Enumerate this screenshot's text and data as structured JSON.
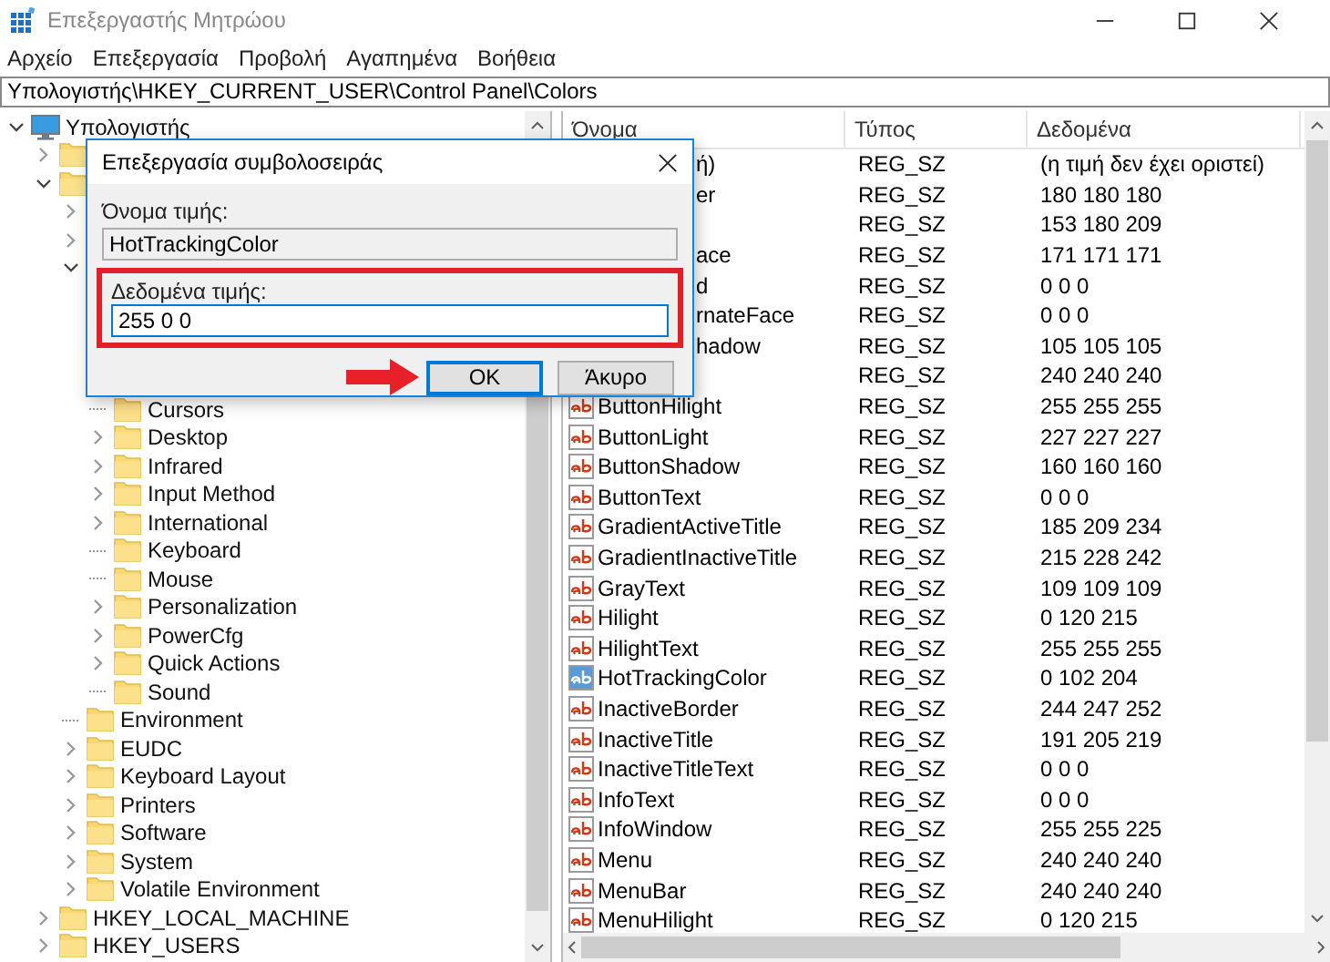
{
  "window": {
    "title": "Επεξεργαστής Μητρώου"
  },
  "menu": [
    "Αρχείο",
    "Επεξεργασία",
    "Προβολή",
    "Αγαπημένα",
    "Βοήθεια"
  ],
  "address": "Υπολογιστής\\HKEY_CURRENT_USER\\Control Panel\\Colors",
  "tree": {
    "items": [
      {
        "kind": "computer",
        "label": "Υπολογιστής",
        "expanded": true,
        "children": [
          {
            "kind": "folder",
            "expanded": false
          },
          {
            "kind": "folder",
            "expanded": true,
            "children": [
              {
                "kind": "chevron",
                "expanded": false
              },
              {
                "kind": "chevron",
                "expanded": false
              },
              {
                "kind": "chevron",
                "expanded": true,
                "children": [
                  {
                    "kind": "covered"
                  },
                  {
                    "kind": "covered"
                  },
                  {
                    "kind": "covered"
                  },
                  {
                    "kind": "covered"
                  },
                  {
                    "kind": "folder",
                    "label": "Cursors"
                  },
                  {
                    "kind": "folder",
                    "label": "Desktop",
                    "expanded": false
                  },
                  {
                    "kind": "folder",
                    "label": "Infrared",
                    "expanded": false
                  },
                  {
                    "kind": "folder",
                    "label": "Input Method",
                    "expanded": false
                  },
                  {
                    "kind": "folder",
                    "label": "International",
                    "expanded": false
                  },
                  {
                    "kind": "folder",
                    "label": "Keyboard"
                  },
                  {
                    "kind": "folder",
                    "label": "Mouse"
                  },
                  {
                    "kind": "folder",
                    "label": "Personalization",
                    "expanded": false
                  },
                  {
                    "kind": "folder",
                    "label": "PowerCfg",
                    "expanded": false
                  },
                  {
                    "kind": "folder",
                    "label": "Quick Actions",
                    "expanded": false
                  },
                  {
                    "kind": "folder",
                    "label": "Sound"
                  }
                ]
              },
              {
                "kind": "folder",
                "label": "Environment"
              },
              {
                "kind": "folder",
                "label": "EUDC",
                "expanded": false
              },
              {
                "kind": "folder",
                "label": "Keyboard Layout",
                "expanded": false
              },
              {
                "kind": "folder",
                "label": "Printers",
                "expanded": false
              },
              {
                "kind": "folder",
                "label": "Software",
                "expanded": false
              },
              {
                "kind": "folder",
                "label": "System",
                "expanded": false
              },
              {
                "kind": "folder",
                "label": "Volatile Environment",
                "expanded": false
              }
            ]
          },
          {
            "kind": "folder",
            "label": "HKEY_LOCAL_MACHINE",
            "expanded": false
          },
          {
            "kind": "folder",
            "label": "HKEY_USERS",
            "expanded": false
          }
        ]
      }
    ]
  },
  "values": {
    "columns": [
      "Όνομα",
      "Τύπος",
      "Δεδομένα"
    ],
    "rows": [
      {
        "kind": "covered",
        "name": "ή)",
        "type": "REG_SZ",
        "data": "(η τιμή δεν έχει οριστεί)",
        "selected": false
      },
      {
        "kind": "covered",
        "name": "er",
        "type": "REG_SZ",
        "data": "180 180 180",
        "selected": false
      },
      {
        "kind": "covered",
        "type": "REG_SZ",
        "data": "153 180 209",
        "selected": false
      },
      {
        "kind": "covered",
        "name": "ace",
        "type": "REG_SZ",
        "data": "171 171 171",
        "selected": false
      },
      {
        "kind": "covered",
        "name": "d",
        "type": "REG_SZ",
        "data": "0 0 0",
        "selected": false
      },
      {
        "kind": "covered",
        "name": "rnateFace",
        "type": "REG_SZ",
        "data": "0 0 0",
        "selected": false
      },
      {
        "kind": "covered",
        "name": "hadow",
        "type": "REG_SZ",
        "data": "105 105 105",
        "selected": false
      },
      {
        "kind": "covered",
        "type": "REG_SZ",
        "data": "240 240 240",
        "selected": false
      },
      {
        "kind": "string",
        "name": "ButtonHilight",
        "type": "REG_SZ",
        "data": "255 255 255",
        "selected": false
      },
      {
        "kind": "string",
        "name": "ButtonLight",
        "type": "REG_SZ",
        "data": "227 227 227",
        "selected": false
      },
      {
        "kind": "string",
        "name": "ButtonShadow",
        "type": "REG_SZ",
        "data": "160 160 160",
        "selected": false
      },
      {
        "kind": "string",
        "name": "ButtonText",
        "type": "REG_SZ",
        "data": "0 0 0",
        "selected": false
      },
      {
        "kind": "string",
        "name": "GradientActiveTitle",
        "type": "REG_SZ",
        "data": "185 209 234",
        "selected": false
      },
      {
        "kind": "string",
        "name": "GradientInactiveTitle",
        "type": "REG_SZ",
        "data": "215 228 242",
        "selected": false
      },
      {
        "kind": "string",
        "name": "GrayText",
        "type": "REG_SZ",
        "data": "109 109 109",
        "selected": false
      },
      {
        "kind": "string",
        "name": "Hilight",
        "type": "REG_SZ",
        "data": "0 120 215",
        "selected": false
      },
      {
        "kind": "string",
        "name": "HilightText",
        "type": "REG_SZ",
        "data": "255 255 255",
        "selected": false
      },
      {
        "kind": "string",
        "name": "HotTrackingColor",
        "type": "REG_SZ",
        "data": "0 102 204",
        "selected": true
      },
      {
        "kind": "string",
        "name": "InactiveBorder",
        "type": "REG_SZ",
        "data": "244 247 252",
        "selected": false
      },
      {
        "kind": "string",
        "name": "InactiveTitle",
        "type": "REG_SZ",
        "data": "191 205 219",
        "selected": false
      },
      {
        "kind": "string",
        "name": "InactiveTitleText",
        "type": "REG_SZ",
        "data": "0 0 0",
        "selected": false
      },
      {
        "kind": "string",
        "name": "InfoText",
        "type": "REG_SZ",
        "data": "0 0 0",
        "selected": false
      },
      {
        "kind": "string",
        "name": "InfoWindow",
        "type": "REG_SZ",
        "data": "255 255 225",
        "selected": false
      },
      {
        "kind": "string",
        "name": "Menu",
        "type": "REG_SZ",
        "data": "240 240 240",
        "selected": false
      },
      {
        "kind": "string",
        "name": "MenuBar",
        "type": "REG_SZ",
        "data": "240 240 240",
        "selected": false
      },
      {
        "kind": "string",
        "name": "MenuHilight",
        "type": "REG_SZ",
        "data": "0 120 215",
        "selected": false
      }
    ]
  },
  "dialog": {
    "title": "Επεξεργασία συμβολοσειράς",
    "name_label": "Όνομα τιμής:",
    "name_value": "HotTrackingColor",
    "data_label": "Δεδομένα τιμής:",
    "data_value": "255 0 0",
    "buttons": [
      "OK",
      "Άκυρο"
    ]
  }
}
